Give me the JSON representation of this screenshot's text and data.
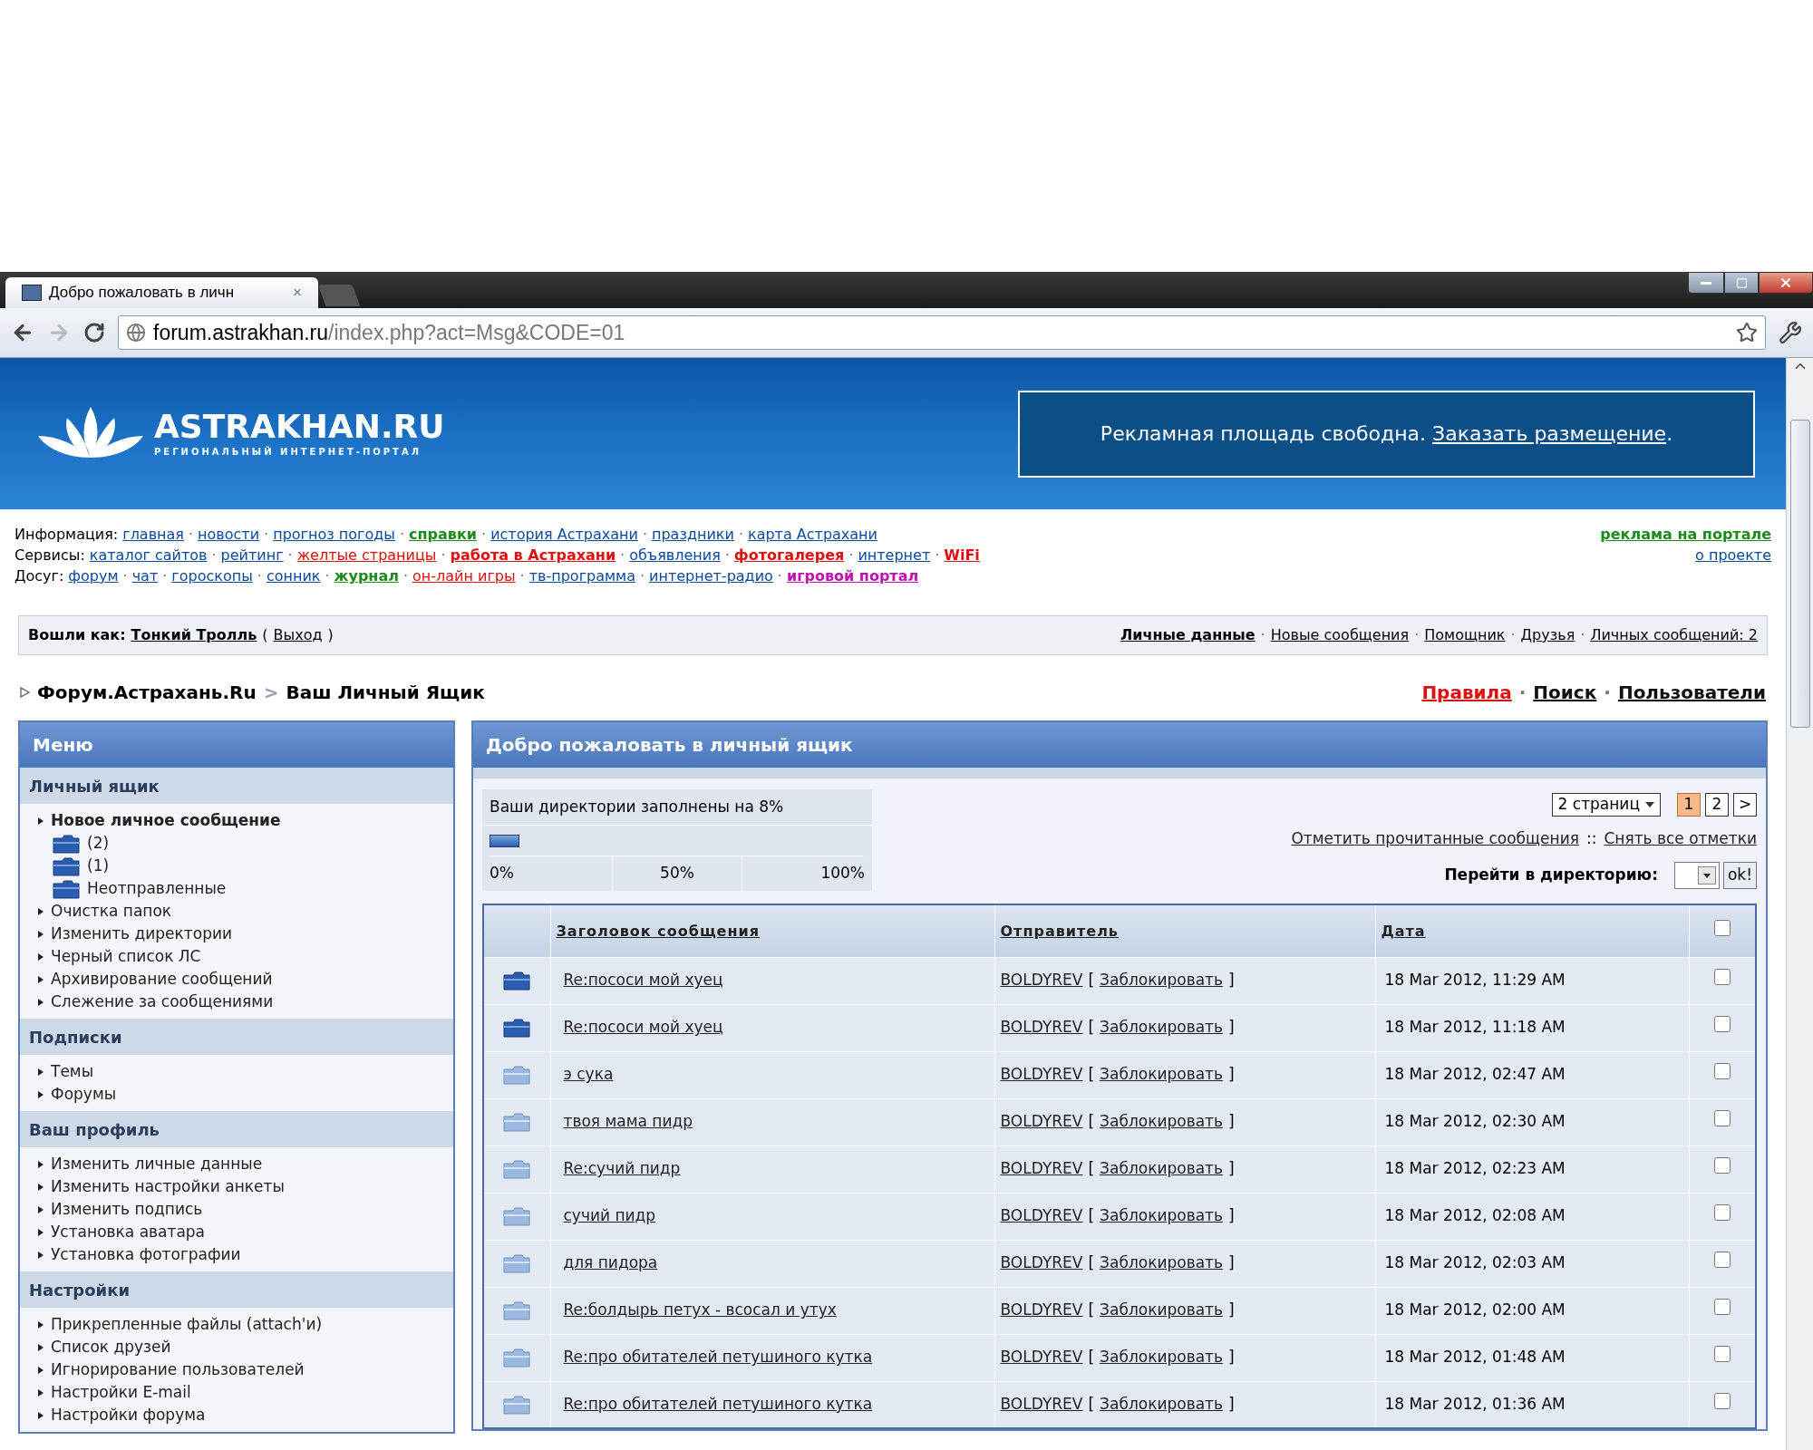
{
  "browser": {
    "tab_title": "Добро пожаловать в личн",
    "tab_close": "×",
    "url_host": "forum.astrakhan.ru",
    "url_path": "/index.php?act=Msg&CODE=01"
  },
  "banner": {
    "logo": "ASTRAKHAN.RU",
    "tagline": "РЕГИОНАЛЬНЫЙ ИНТЕРНЕТ-ПОРТАЛ",
    "ad_text": "Рекламная площадь свободна.",
    "ad_link": "Заказать размещение",
    "ad_end": "."
  },
  "nav": {
    "separator": "·",
    "rows": [
      {
        "label": "Информация:",
        "links": [
          {
            "text": "главная",
            "color": "#0b4a9a",
            "bold": false
          },
          {
            "text": "новости",
            "color": "#0b4a9a",
            "bold": false
          },
          {
            "text": "прогноз погоды",
            "color": "#0b4a9a",
            "bold": false
          },
          {
            "text": "справки",
            "color": "#1e8a1e",
            "bold": true
          },
          {
            "text": "история Астрахани",
            "color": "#0b4a9a",
            "bold": false
          },
          {
            "text": "праздники",
            "color": "#0b4a9a",
            "bold": false
          },
          {
            "text": "карта Астрахани",
            "color": "#0b4a9a",
            "bold": false
          }
        ]
      },
      {
        "label": "Сервисы:",
        "links": [
          {
            "text": "каталог сайтов",
            "color": "#0b4a9a",
            "bold": false
          },
          {
            "text": "рейтинг",
            "color": "#0b4a9a",
            "bold": false
          },
          {
            "text": "желтые страницы",
            "color": "#e01010",
            "bold": false
          },
          {
            "text": "работа в Астрахани",
            "color": "#e01010",
            "bold": true
          },
          {
            "text": "объявления",
            "color": "#0b4a9a",
            "bold": false
          },
          {
            "text": "фотогалерея",
            "color": "#e01010",
            "bold": true
          },
          {
            "text": "интернет",
            "color": "#0b4a9a",
            "bold": false
          },
          {
            "text": "WiFi",
            "color": "#e01010",
            "bold": true
          }
        ]
      },
      {
        "label": "Досуг:",
        "links": [
          {
            "text": "форум",
            "color": "#0b4a9a",
            "bold": false
          },
          {
            "text": "чат",
            "color": "#0b4a9a",
            "bold": false
          },
          {
            "text": "гороскопы",
            "color": "#0b4a9a",
            "bold": false
          },
          {
            "text": "сонник",
            "color": "#0b4a9a",
            "bold": false
          },
          {
            "text": "журнал",
            "color": "#1e8a1e",
            "bold": true
          },
          {
            "text": "он-лайн игры",
            "color": "#e01010",
            "bold": false
          },
          {
            "text": "тв-программа",
            "color": "#0b4a9a",
            "bold": false
          },
          {
            "text": "интернет-радио",
            "color": "#0b4a9a",
            "bold": false
          },
          {
            "text": "игровой портал",
            "color": "#c010b0",
            "bold": true
          }
        ]
      }
    ],
    "right": [
      {
        "text": "реклама на портале",
        "color": "#1e8a1e",
        "bold": true
      },
      {
        "text": "о проекте",
        "color": "#0b4a9a",
        "bold": false
      }
    ]
  },
  "user_bar": {
    "prefix": "Вошли как:",
    "user": "Тонкий Тролль",
    "paren_open": "(",
    "logout": "Выход",
    "paren_close": ")",
    "separator": "·",
    "links": [
      {
        "text": "Личные данные",
        "bold": true
      },
      {
        "text": "Новые сообщения",
        "bold": false
      },
      {
        "text": "Помощник",
        "bold": false
      },
      {
        "text": "Друзья",
        "bold": false
      },
      {
        "text": "Личных сообщений: 2",
        "bold": false
      }
    ]
  },
  "breadcrumb": {
    "items": [
      "Форум.Астрахань.Ru",
      "Ваш Личный Ящик"
    ],
    "separator": ">",
    "top_separator": "·",
    "top_links": [
      {
        "text": "Правила",
        "color": "#e01010"
      },
      {
        "text": "Поиск",
        "color": "#111111"
      },
      {
        "text": "Пользователи",
        "color": "#111111"
      }
    ]
  },
  "sidebar": {
    "title": "Меню",
    "sections": [
      {
        "title": "Личный ящик",
        "items": [
          {
            "label": "Новое личное сообщение",
            "kind": "link",
            "bold": true
          },
          {
            "label": "(2)",
            "kind": "folder",
            "bold": false
          },
          {
            "label": "(1)",
            "kind": "folder",
            "bold": false
          },
          {
            "label": "Неотправленные",
            "kind": "folder",
            "bold": false
          },
          {
            "label": "Очистка папок",
            "kind": "link",
            "bold": false
          },
          {
            "label": "Изменить директории",
            "kind": "link",
            "bold": false
          },
          {
            "label": "Черный список ЛС",
            "kind": "link",
            "bold": false
          },
          {
            "label": "Архивирование сообщений",
            "kind": "link",
            "bold": false
          },
          {
            "label": "Слежение за сообщениями",
            "kind": "link",
            "bold": false
          }
        ]
      },
      {
        "title": "Подписки",
        "items": [
          {
            "label": "Темы",
            "kind": "link",
            "bold": false
          },
          {
            "label": "Форумы",
            "kind": "link",
            "bold": false
          }
        ]
      },
      {
        "title": "Ваш профиль",
        "items": [
          {
            "label": "Изменить личные данные",
            "kind": "link",
            "bold": false
          },
          {
            "label": "Изменить настройки анкеты",
            "kind": "link",
            "bold": false
          },
          {
            "label": "Изменить подпись",
            "kind": "link",
            "bold": false
          },
          {
            "label": "Установка аватара",
            "kind": "link",
            "bold": false
          },
          {
            "label": "Установка фотографии",
            "kind": "link",
            "bold": false
          }
        ]
      },
      {
        "title": "Настройки",
        "items": [
          {
            "label": "Прикрепленные файлы (attach'и)",
            "kind": "link",
            "bold": false
          },
          {
            "label": "Список друзей",
            "kind": "link",
            "bold": false
          },
          {
            "label": "Игнорирование пользователей",
            "kind": "link",
            "bold": false
          },
          {
            "label": "Настройки E-mail",
            "kind": "link",
            "bold": false
          },
          {
            "label": "Настройки форума",
            "kind": "link",
            "bold": false
          }
        ]
      }
    ]
  },
  "main": {
    "title": "Добро пожаловать в личный ящик",
    "storage": {
      "label": "Ваши директории заполнены на 8%",
      "level": 0.08,
      "scale": [
        "0%",
        "50%",
        "100%"
      ]
    },
    "pages_dropdown": "2 страниц",
    "pages": [
      {
        "label": "1",
        "selected": true
      },
      {
        "label": "2",
        "selected": false
      },
      {
        "label": ">",
        "selected": false
      }
    ],
    "mark_read": "Отметить прочитанные сообщения",
    "mark_separator": "::",
    "unmark": "Снять все отметки",
    "goto_label": "Перейти в директорию:",
    "ok": "ok!",
    "table": {
      "columns": [
        "Заголовок сообщения",
        "Отправитель",
        "Дата"
      ],
      "header_checked": false,
      "action_brackets": [
        "[",
        "]"
      ],
      "rows": [
        {
          "title": "Re:пососи мой хуец",
          "sender": "BOLDYREV",
          "action": "Заблокировать",
          "date": "18 Mar 2012, 11:29 AM",
          "unread": true,
          "checked": false
        },
        {
          "title": "Re:пососи мой хуец",
          "sender": "BOLDYREV",
          "action": "Заблокировать",
          "date": "18 Mar 2012, 11:18 AM",
          "unread": true,
          "checked": false
        },
        {
          "title": "э сука",
          "sender": "BOLDYREV",
          "action": "Заблокировать",
          "date": "18 Mar 2012, 02:47 AM",
          "unread": false,
          "checked": false
        },
        {
          "title": "твоя мама пидр",
          "sender": "BOLDYREV",
          "action": "Заблокировать",
          "date": "18 Mar 2012, 02:30 AM",
          "unread": false,
          "checked": false
        },
        {
          "title": "Re:сучий пидр",
          "sender": "BOLDYREV",
          "action": "Заблокировать",
          "date": "18 Mar 2012, 02:23 AM",
          "unread": false,
          "checked": false
        },
        {
          "title": "сучий пидр",
          "sender": "BOLDYREV",
          "action": "Заблокировать",
          "date": "18 Mar 2012, 02:08 AM",
          "unread": false,
          "checked": false
        },
        {
          "title": "для пидора",
          "sender": "BOLDYREV",
          "action": "Заблокировать",
          "date": "18 Mar 2012, 02:03 AM",
          "unread": false,
          "checked": false
        },
        {
          "title": "Re:болдырь петух - всосал и утух",
          "sender": "BOLDYREV",
          "action": "Заблокировать",
          "date": "18 Mar 2012, 02:00 AM",
          "unread": false,
          "checked": false
        },
        {
          "title": "Re:про обитателей петушиного кутка",
          "sender": "BOLDYREV",
          "action": "Заблокировать",
          "date": "18 Mar 2012, 01:48 AM",
          "unread": false,
          "checked": false
        },
        {
          "title": "Re:про обитателей петушиного кутка",
          "sender": "BOLDYREV",
          "action": "Заблокировать",
          "date": "18 Mar 2012, 01:36 AM",
          "unread": false,
          "checked": false
        }
      ]
    }
  }
}
